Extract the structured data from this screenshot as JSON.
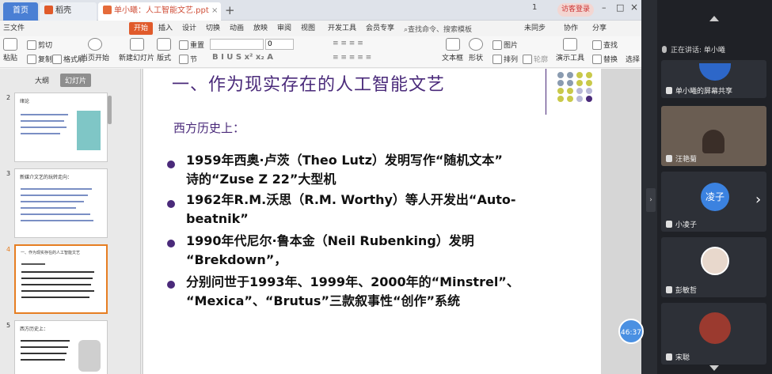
{
  "tabs": {
    "home": "首页",
    "daoke": "稻壳",
    "doc": "单小曦：人工智能文艺.ppt",
    "new_tab": "+"
  },
  "window": {
    "page_indicator": "1",
    "visitor": "访客登录",
    "min": "–",
    "max": "□",
    "close": "×"
  },
  "menu": {
    "file": "三文件",
    "start": "开始",
    "insert": "插入",
    "design": "设计",
    "switch": "切换",
    "animation": "动画",
    "slideshow": "放映",
    "review": "审阅",
    "view": "视图",
    "devtools": "开发工具",
    "vip": "会员专享",
    "search": "查找命令、搜索模板",
    "unsynced": "未同步",
    "collab": "协作",
    "share": "分享"
  },
  "toolbar": {
    "paste": "粘贴",
    "cut": "剪切",
    "copy": "复制",
    "format_painter": "格式刷",
    "from_start": "当页开始",
    "new_slide": "新建幻灯片",
    "layout": "版式",
    "section": "节",
    "reset": "重置",
    "font_size": "0",
    "textbox": "文本框",
    "shape": "形状",
    "picture": "图片",
    "arrange": "排列",
    "outline": "轮廓",
    "present_tool": "演示工具",
    "find": "查找",
    "replace": "替换",
    "select": "选择"
  },
  "left_panel": {
    "outline_tab": "大纲",
    "slides_tab": "幻灯片",
    "thumbs": [
      {
        "num": "2",
        "title": "绪论"
      },
      {
        "num": "3",
        "title": "新媒介文艺的玩转走向："
      },
      {
        "num": "4",
        "title": "一、作为现实存在的人工智能文艺"
      },
      {
        "num": "5",
        "title": "西方历史上："
      }
    ]
  },
  "slide": {
    "title": "一、作为现实存在的人工智能文艺",
    "subheading": "西方历史上：",
    "bullets": [
      {
        "line1": "1959年西奥·卢茨（Theo Lutz）发明写作“随机文本”",
        "line2": "诗的“Zuse Z 22”大型机"
      },
      {
        "line1": "1962年R.M.沃思（R.M. Worthy）等人开发出“Auto-",
        "line2": "beatnik”"
      },
      {
        "line1": "1990年代尼尔·鲁本金（Neil Rubenking）发明",
        "line2": "“Brekdown”，"
      },
      {
        "line1": "分别问世于1993年、1999年、2000年的“Minstrel”、",
        "line2": "“Mexica”、“Brutus”三款叙事性“创作”系统"
      }
    ],
    "dot_colors": [
      "#8a9bb0",
      "#c9c94a",
      "#b8b8d8",
      "#4a2a7a"
    ]
  },
  "timer": "46:37",
  "meeting": {
    "speaking_label": "正在讲话: 单小曦",
    "participants": [
      {
        "name": "单小曦的屏幕共享"
      },
      {
        "name": "汪艳菊"
      },
      {
        "name": "小凌子",
        "avatar_text": "凌子"
      },
      {
        "name": "彭敏哲"
      },
      {
        "name": "宋聪"
      }
    ]
  }
}
